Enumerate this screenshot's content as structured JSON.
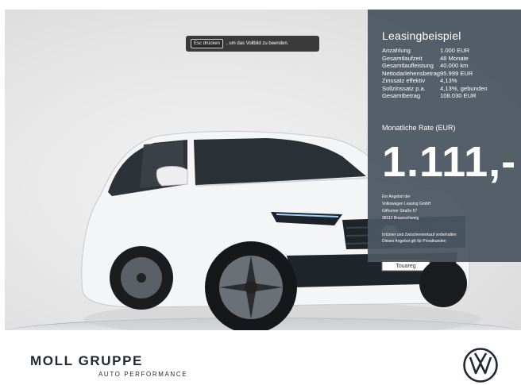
{
  "toast": {
    "key": "Esc drücken",
    "text": ", um das Vollbild zu beenden."
  },
  "leasing": {
    "title": "Leasingbeispiel",
    "rows": [
      {
        "label": "Anzahlung",
        "value": "1.000 EUR"
      },
      {
        "label": "Gesamtlaufzeit",
        "value": "48 Monate"
      },
      {
        "label": "Gesamtlaufleistung",
        "value": "40.000 km"
      },
      {
        "label": "Nettodarlehensbetrag",
        "value": "95.999 EUR"
      },
      {
        "label": "Zinssatz effektiv",
        "value": "4,13%"
      },
      {
        "label": "Sollzinssatz p.a.",
        "value": "4,13%, gebunden"
      },
      {
        "label": "Gesamtbetrag",
        "value": "108.030 EUR"
      }
    ],
    "rate_label": "Monatliche Rate (EUR)",
    "rate_value": "1.111,-",
    "provider": [
      "Ein Angebot der",
      "Volkswagen Leasing GmbH",
      "Gifhorner Straße 57",
      "38112 Braunschweig"
    ],
    "disclaimer": [
      "Irrtümer und Zwischenverkauf vorbehalten",
      "Dieses Angebot gilt für Privatkunden"
    ]
  },
  "car": {
    "plate": "Touareg"
  },
  "brand": {
    "name": "MOLL GRUPPE",
    "subtitle": "AUTO PERFORMANCE",
    "logo_icon": "vw-logo-icon"
  },
  "colors": {
    "panel": "#4a5662",
    "logo": "#1f2933"
  }
}
